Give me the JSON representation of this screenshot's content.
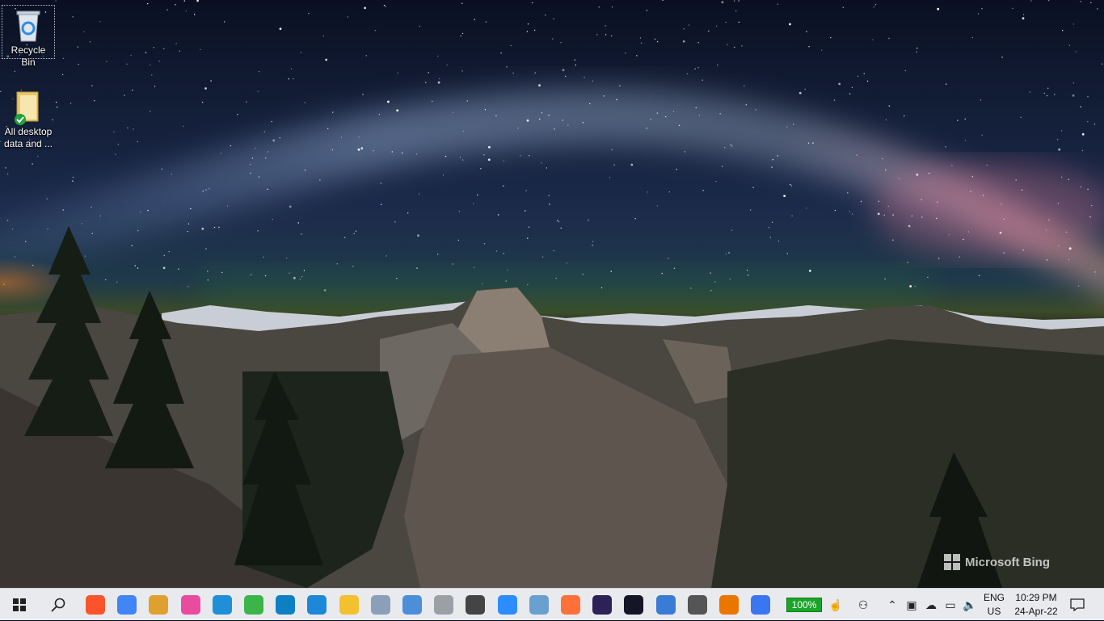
{
  "desktop": {
    "icons": [
      {
        "label": "Recycle Bin"
      },
      {
        "label": "All desktop data and ..."
      }
    ],
    "watermark": "Microsoft Bing"
  },
  "taskbar": {
    "battery_percent": "100%",
    "language": {
      "line1": "ENG",
      "line2": "US"
    },
    "clock": {
      "time": "10:29 PM",
      "date": "24-Apr-22"
    },
    "apps": [
      {
        "name": "brave-icon",
        "color": "#fb542b"
      },
      {
        "name": "chrome-icon",
        "color": "#4285f4"
      },
      {
        "name": "paint-icon",
        "color": "#e0a030"
      },
      {
        "name": "wps-icon",
        "color": "#e94b9f"
      },
      {
        "name": "vscode-icon",
        "color": "#1f8fd8"
      },
      {
        "name": "vpn-icon",
        "color": "#3bb54a"
      },
      {
        "name": "edge-icon",
        "color": "#0f7fc4"
      },
      {
        "name": "fishing-app-icon",
        "color": "#1e88d8"
      },
      {
        "name": "file-explorer-icon",
        "color": "#f3c030"
      },
      {
        "name": "photos-icon",
        "color": "#8aa0b8"
      },
      {
        "name": "qbittorrent-icon",
        "color": "#4c8fd8"
      },
      {
        "name": "shield-app-icon",
        "color": "#9aa0a6"
      },
      {
        "name": "calendar-icon",
        "color": "#444"
      },
      {
        "name": "zoom-icon",
        "color": "#2d8cff"
      },
      {
        "name": "notes-app-icon",
        "color": "#6aa0d0"
      },
      {
        "name": "firefox-icon",
        "color": "#ff7139"
      },
      {
        "name": "eclipse-icon",
        "color": "#2c2255"
      },
      {
        "name": "speedtest-icon",
        "color": "#141526"
      },
      {
        "name": "rocket-app-icon",
        "color": "#3a7bd5"
      },
      {
        "name": "clock-app-icon",
        "color": "#555"
      },
      {
        "name": "blender-icon",
        "color": "#ea7600"
      },
      {
        "name": "signal-icon",
        "color": "#3a76f0"
      }
    ]
  }
}
